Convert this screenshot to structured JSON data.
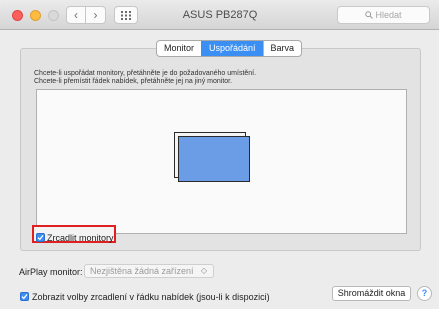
{
  "window": {
    "title": "ASUS PB287Q",
    "search_placeholder": "Hledat",
    "back_glyph": "‹",
    "forward_glyph": "›"
  },
  "tabs": [
    {
      "label": "Monitor",
      "active": false
    },
    {
      "label": "Uspořádání",
      "active": true
    },
    {
      "label": "Barva",
      "active": false
    }
  ],
  "arrangement": {
    "instruction_line1": "Chcete-li uspořádat monitory, přetáhněte je do požadovaného umístění.",
    "instruction_line2": "Chcete-li přemístit řádek nabídek, přetáhněte jej na jiný monitor.",
    "monitor_color": "#6a9de6",
    "mirror_label": "Zrcadlit monitory",
    "mirror_checked": true,
    "highlight_color": "#e02020"
  },
  "bottom": {
    "airplay_label": "AirPlay monitor:",
    "airplay_value": "Nezjištěna žádná zařízení",
    "show_mirroring_label": "Zobrazit volby zrcadlení v řádku nabídek (jsou-li k dispozici)",
    "show_mirroring_checked": true,
    "collect_button": "Shromáždit okna",
    "help_glyph": "?"
  },
  "icons": [
    "close-light",
    "minimize-light",
    "zoom-light",
    "chevron-left-icon",
    "chevron-right-icon",
    "grid-icon",
    "search-icon",
    "checkmark-icon",
    "help-icon"
  ],
  "colors": {
    "accent": "#3b8ff2"
  }
}
